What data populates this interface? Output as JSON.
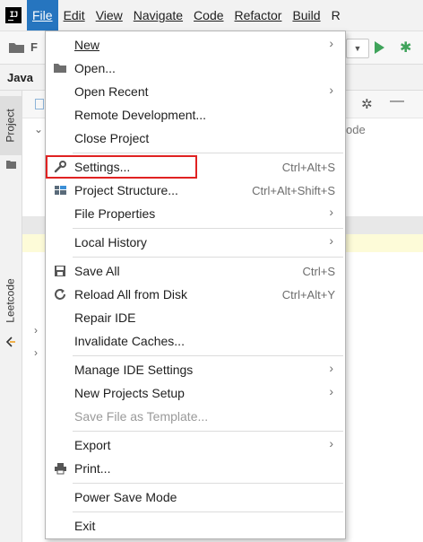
{
  "menubar": {
    "logo_text": "IJ",
    "items": [
      {
        "label": "File",
        "active": true
      },
      {
        "label": "Edit"
      },
      {
        "label": "View"
      },
      {
        "label": "Navigate"
      },
      {
        "label": "Code"
      },
      {
        "label": "Refactor"
      },
      {
        "label": "Build"
      },
      {
        "label": "R"
      }
    ]
  },
  "toolbar": {
    "project_chip": "F",
    "breadcrumb": "Java"
  },
  "toolstrip": {
    "project_tab": "Project",
    "leetcode_tab": "Leetcode"
  },
  "panel": {
    "code_hint": "ode"
  },
  "file_menu": {
    "items": [
      {
        "label": "New",
        "shortcut": "",
        "submenu": true,
        "icon": ""
      },
      {
        "label": "Open...",
        "shortcut": "",
        "submenu": false,
        "icon": "folder-icon"
      },
      {
        "label": "Open Recent",
        "shortcut": "",
        "submenu": true,
        "icon": ""
      },
      {
        "label": "Remote Development...",
        "shortcut": "",
        "submenu": false,
        "icon": ""
      },
      {
        "label": "Close Project",
        "shortcut": "",
        "submenu": false,
        "icon": ""
      },
      {
        "label": "Settings...",
        "shortcut": "Ctrl+Alt+S",
        "submenu": false,
        "icon": "wrench-icon"
      },
      {
        "label": "Project Structure...",
        "shortcut": "Ctrl+Alt+Shift+S",
        "submenu": false,
        "icon": "project-structure-icon"
      },
      {
        "label": "File Properties",
        "shortcut": "",
        "submenu": true,
        "icon": ""
      },
      {
        "label": "Local History",
        "shortcut": "",
        "submenu": true,
        "icon": ""
      },
      {
        "label": "Save All",
        "shortcut": "Ctrl+S",
        "submenu": false,
        "icon": "save-icon"
      },
      {
        "label": "Reload All from Disk",
        "shortcut": "Ctrl+Alt+Y",
        "submenu": false,
        "icon": "reload-icon"
      },
      {
        "label": "Repair IDE",
        "shortcut": "",
        "submenu": false,
        "icon": ""
      },
      {
        "label": "Invalidate Caches...",
        "shortcut": "",
        "submenu": false,
        "icon": ""
      },
      {
        "label": "Manage IDE Settings",
        "shortcut": "",
        "submenu": true,
        "icon": ""
      },
      {
        "label": "New Projects Setup",
        "shortcut": "",
        "submenu": true,
        "icon": ""
      },
      {
        "label": "Save File as Template...",
        "shortcut": "",
        "submenu": false,
        "icon": "",
        "disabled": true
      },
      {
        "label": "Export",
        "shortcut": "",
        "submenu": true,
        "icon": ""
      },
      {
        "label": "Print...",
        "shortcut": "",
        "submenu": false,
        "icon": "print-icon"
      },
      {
        "label": "Power Save Mode",
        "shortcut": "",
        "submenu": false,
        "icon": ""
      },
      {
        "label": "Exit",
        "shortcut": "",
        "submenu": false,
        "icon": ""
      }
    ]
  },
  "colors": {
    "menu_active": "#2675bf",
    "highlight_box": "#e02222",
    "run_green": "#3fa35a"
  }
}
